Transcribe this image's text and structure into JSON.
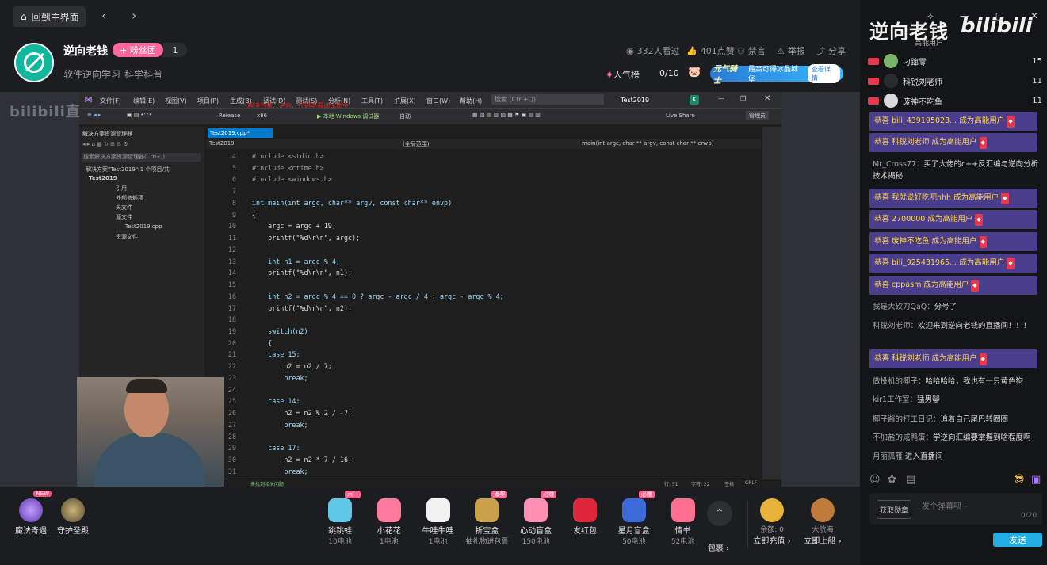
{
  "topbar": {
    "home_label": "回到主界面",
    "back_icon": "chevron-left-icon",
    "forward_icon": "chevron-right-icon"
  },
  "streamer": {
    "name": "逆向老钱",
    "fans_button": "+ 粉丝团",
    "fans_count": "1",
    "tags": [
      "软件逆向学习",
      "科学科普"
    ],
    "viewers": "332人看过",
    "likes": "401点赞",
    "mute": "禁言",
    "report": "举报",
    "share": "分享",
    "hot_rank": "人气榜",
    "rank_count": "0/10"
  },
  "promo": {
    "brand": "元气骑士",
    "text": "最高可得冰晶城堡",
    "button": "查看详情"
  },
  "watermark": "bilibili直播",
  "vs": {
    "menus": [
      "文件(F)",
      "编辑(E)",
      "视图(V)",
      "项目(P)",
      "生成(B)",
      "调试(D)",
      "测试(S)",
      "分析(N)",
      "工具(T)",
      "扩展(X)",
      "窗口(W)",
      "帮助(H)"
    ],
    "search_placeholder": "搜索 (Ctrl+Q)",
    "project_title": "Test2019",
    "account_initial": "K",
    "red_note": "解决方案、逆向、代码查看调试命令",
    "config": "Release",
    "platform": "x86",
    "run_label": "▶ 本地 Windows 调试器",
    "run_mode": "自动",
    "live_share": "Live Share",
    "admin": "管理员",
    "solution_panel_title": "解决方案资源管理器",
    "solution_search": "搜索解决方案资源管理器(Ctrl+;)",
    "solution_items": [
      "解决方案\"Test2019\"(1 个项目/共",
      "Test2019",
      "引用",
      "外部依赖项",
      "头文件",
      "源文件",
      "Test2019.cpp",
      "资源文件"
    ],
    "tab": "Test2019.cpp*",
    "nav_left": "Test2019",
    "nav_mid": "(全局范围)",
    "nav_right": "main(int argc, char ** argv, const char ** envp)",
    "status_issue": "未找到相关问题",
    "status_line": "行: 51",
    "status_char": "字符: 22",
    "status_space": "空格",
    "status_crlf": "CRLF"
  },
  "code": {
    "line_numbers": [
      "4",
      "5",
      "6",
      "7",
      "8",
      "9",
      "10",
      "11",
      "12",
      "13",
      "14",
      "15",
      "16",
      "17",
      "18",
      "19",
      "20",
      "21",
      "22",
      "23",
      "24",
      "25",
      "26",
      "27",
      "28",
      "29",
      "30",
      "31"
    ],
    "lines": [
      "#include <stdio.h>",
      "#include <ctime.h>",
      "#include <windows.h>",
      "",
      "int main(int argc, char** argv, const char** envp)",
      "{",
      "    argc = argc + 19;",
      "    printf(\"%d\\r\\n\", argc);",
      "",
      "    int n1 = argc % 4;",
      "    printf(\"%d\\r\\n\", n1);",
      "",
      "    int n2 = argc % 4 == 0 ? argc - argc / 4 : argc - argc % 4;",
      "    printf(\"%d\\r\\n\", n2);",
      "",
      "    switch(n2)",
      "    {",
      "    case 15:",
      "        n2 = n2 / 7;",
      "        break;",
      "",
      "    case 14:",
      "        n2 = n2 % 2 / -7;",
      "        break;",
      "",
      "    case 17:",
      "        n2 = n2 * 7 / 16;",
      "        break;"
    ]
  },
  "left_actions": [
    {
      "name": "魔法奇遇",
      "badge": "NEW"
    },
    {
      "name": "守护圣殿"
    }
  ],
  "gifts": [
    {
      "name": "跳跳蛙",
      "price": "10电池",
      "badge": "六一",
      "color": "#5fc7e8"
    },
    {
      "name": "小花花",
      "price": "1电池",
      "badge": "",
      "color": "#ff7a9c"
    },
    {
      "name": "牛哇牛哇",
      "price": "1电池",
      "badge": "",
      "color": "#f2f2f2"
    },
    {
      "name": "折宝盒",
      "price": "抽礼物进包裹",
      "badge": "爆奖",
      "color": "#c9a14a"
    },
    {
      "name": "心动盲盒",
      "price": "150电池",
      "badge": "必赚",
      "color": "#ff8fb3"
    },
    {
      "name": "发红包",
      "price": "",
      "badge": "",
      "color": "#e0243a"
    },
    {
      "name": "星月盲盒",
      "price": "50电池",
      "badge": "必赚",
      "color": "#3a6bd8"
    },
    {
      "name": "情书",
      "price": "52电池",
      "badge": "",
      "color": "#ff6f8f"
    }
  ],
  "gift_more": {
    "label": "包裹 ›"
  },
  "wallet": {
    "balance": "余额: 0",
    "recharge": "立即充值 ›",
    "voyage": "大航海",
    "board": "立即上船 ›"
  },
  "right_panel": {
    "logo": "逆向老钱",
    "bili": "bilibili",
    "top_label": "高能用户",
    "ranks": [
      {
        "name": "刁蹿零",
        "num": "15"
      },
      {
        "name": "科锐刘老师",
        "num": "11"
      },
      {
        "name": "废神不吃鱼",
        "num": "11"
      }
    ],
    "messages": [
      {
        "type": "box",
        "text": "恭喜 bili_439195023... 成为高能用户"
      },
      {
        "type": "box",
        "text": "恭喜 科锐刘老师 成为高能用户"
      },
      {
        "type": "plain",
        "user": "Mr_Cross77：",
        "content": "买了大佬的c++反汇编与逆向分析技术揭秘"
      },
      {
        "type": "box",
        "text": "恭喜 我就说好吃吧hhh 成为高能用户"
      },
      {
        "type": "box",
        "text": "恭喜 2700000 成为高能用户"
      },
      {
        "type": "box",
        "text": "恭喜 废神不吃鱼 成为高能用户"
      },
      {
        "type": "box",
        "text": "恭喜 bili_925431965... 成为高能用户"
      },
      {
        "type": "box",
        "text": "恭喜 cppasm 成为高能用户"
      },
      {
        "type": "plain",
        "user": "我是大砍刀QaQ：",
        "content": "分号了"
      },
      {
        "type": "plain",
        "user": "科锐刘老师：",
        "content": "欢迎来到逆向老钱的直播间！！！"
      },
      {
        "type": "box",
        "text": "恭喜 科锐刘老师 成为高能用户"
      },
      {
        "type": "plain",
        "user": "做投机的椰子：",
        "content": "哈哈哈哈，我也有一只黄色狗"
      },
      {
        "type": "plain",
        "user": "kir1工作室：",
        "content": "猛男😸"
      },
      {
        "type": "plain",
        "user": "椰子酱的打工日记：",
        "content": "追着自己尾巴转圈圈"
      },
      {
        "type": "plain",
        "user": "不加盐的咸鸭蛋：",
        "content": "学逆向汇编要掌握到啥程度啊"
      },
      {
        "type": "plain",
        "user": "月丽孤雁",
        "content": " 进入直播间"
      }
    ],
    "input_tag": "获取勋章",
    "input_placeholder": "发个弹幕呗~",
    "input_count": "0/20",
    "send": "发送"
  }
}
